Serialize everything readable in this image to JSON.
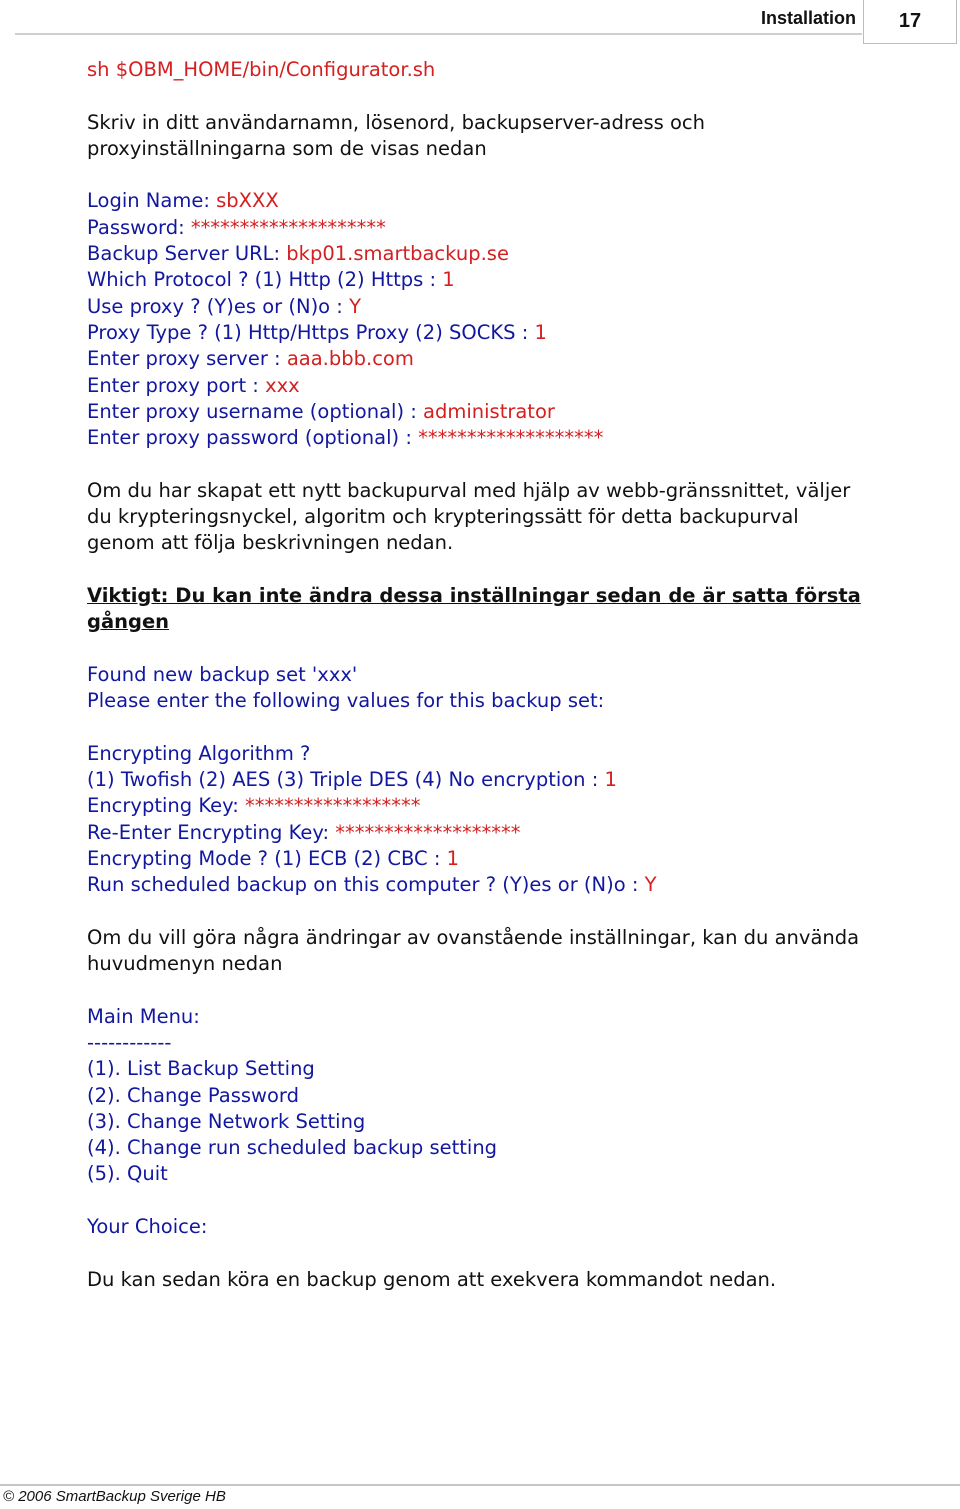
{
  "header": {
    "section_title": "Installation",
    "page_number": "17"
  },
  "command": "sh $OBM_HOME/bin/Configurator.sh",
  "intro": {
    "line1": "Skriv in ditt användarnamn, lösenord, backupserver-adress och",
    "line2": "proxyinställningarna som de visas nedan"
  },
  "config_prompts": [
    {
      "prompt": "Login Name: ",
      "value": "sbXXX"
    },
    {
      "prompt": "Password: ",
      "value": "********************"
    },
    {
      "prompt": "Backup Server URL: ",
      "value": "bkp01.smartbackup.se"
    },
    {
      "prompt": "Which Protocol ? (1) Http (2) Https : ",
      "value": "1"
    },
    {
      "prompt": "Use proxy ? (Y)es or (N)o : ",
      "value": "Y"
    },
    {
      "prompt": "Proxy Type ? (1) Http/Https Proxy (2) SOCKS : ",
      "value": "1"
    },
    {
      "prompt": "Enter proxy server : ",
      "value": "aaa.bbb.com"
    },
    {
      "prompt": "Enter proxy port : ",
      "value": "xxx"
    },
    {
      "prompt": "Enter proxy username (optional) : ",
      "value": "administrator"
    },
    {
      "prompt": "Enter proxy password (optional) : ",
      "value": "*******************"
    }
  ],
  "backup_set_info": {
    "line1": "Om du har skapat ett nytt backupurval med hjälp av webb-gränssnittet, väljer",
    "line2": "du krypteringsnyckel, algoritm och krypteringssätt för detta backupurval",
    "line3": "genom att följa beskrivningen nedan."
  },
  "warning": {
    "line1": "Viktigt: Du kan inte ändra dessa inställningar sedan de är satta första",
    "line2": "gången"
  },
  "backup_set": {
    "found": "Found new backup set 'xxx'",
    "instruction": "Please enter the following values for this backup set:",
    "algorithm_question": "Encrypting Algorithm ?",
    "prompts": [
      {
        "prompt": "(1) Twofish (2) AES (3) Triple DES (4) No encryption : ",
        "value": "1"
      },
      {
        "prompt": "Encrypting Key: ",
        "value": "******************"
      },
      {
        "prompt": "Re-Enter Encrypting Key: ",
        "value": "*******************"
      },
      {
        "prompt": "Encrypting Mode ? (1) ECB (2) CBC : ",
        "value": "1"
      },
      {
        "prompt": "Run scheduled backup on this computer ? (Y)es or (N)o : ",
        "value": "Y"
      }
    ]
  },
  "menu_info": {
    "line1": "Om du vill göra några ändringar av ovanstående inställningar, kan du använda",
    "line2": "huvudmenyn nedan"
  },
  "main_menu": {
    "title": "Main Menu:",
    "separator": "------------",
    "items": [
      "(1). List Backup Setting",
      "(2). Change Password",
      "(3). Change Network Setting",
      "(4). Change run scheduled backup setting",
      "(5). Quit"
    ],
    "choice_prompt": "Your Choice:"
  },
  "closing": "Du kan sedan köra en backup genom att exekvera kommandot nedan.",
  "footer": {
    "copyright": "© 2006 SmartBackup Sverige HB"
  }
}
